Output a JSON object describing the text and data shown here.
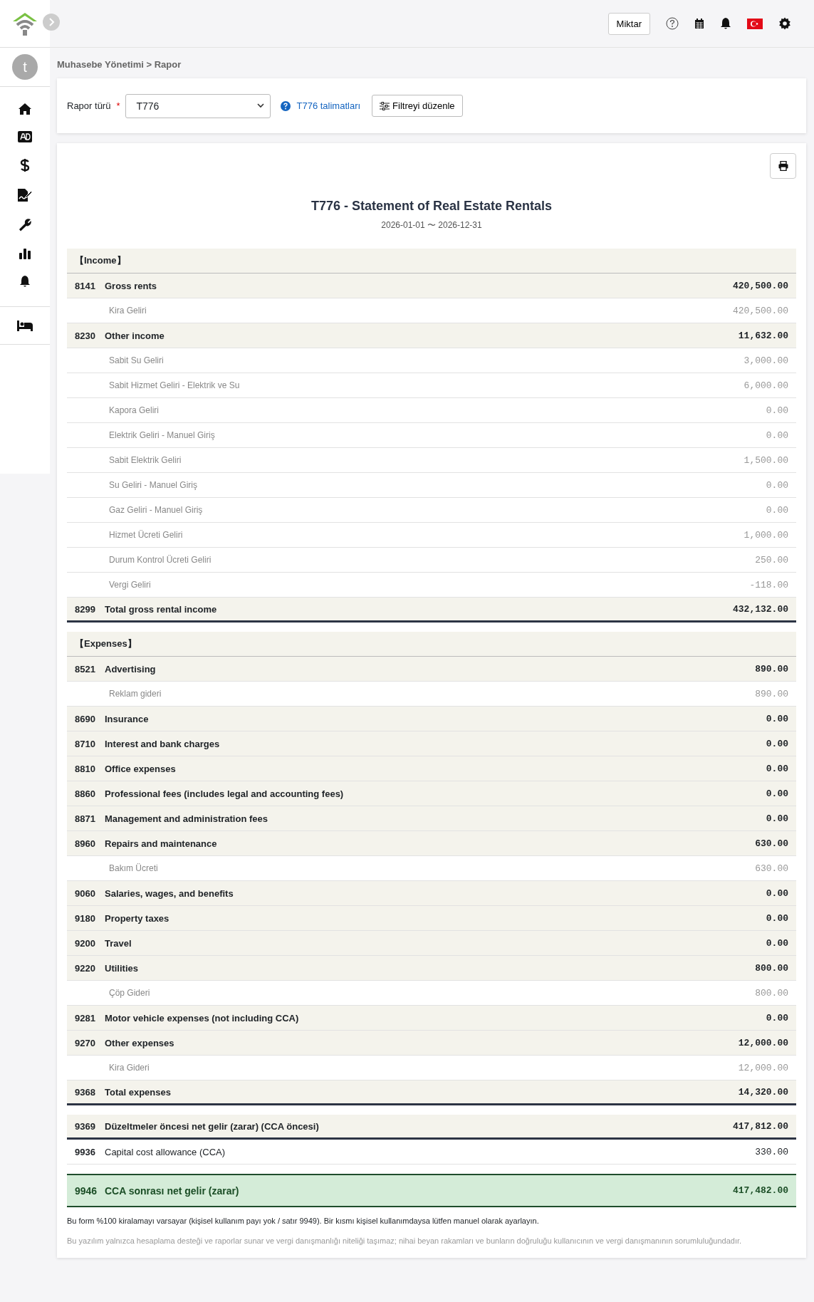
{
  "topbar": {
    "quantity_button": "Miktar"
  },
  "sidebar": {
    "avatar": "t"
  },
  "breadcrumb": "Muhasebe Yönetimi > Rapor",
  "filter": {
    "label": "Rapor türü",
    "required": "*",
    "report_type": "T776",
    "help_link": "T776 talimatları",
    "edit_button": "Filtreyi düzenle"
  },
  "report": {
    "title": "T776 - Statement of Real Estate Rentals",
    "period": "2026-01-01 〜 2026-12-31",
    "groups": [
      [
        {
          "kind": "section",
          "label": "【Income】"
        },
        {
          "kind": "account",
          "code": "8141",
          "label": "Gross rents",
          "amount": "420,500.00"
        },
        {
          "kind": "detail",
          "label": "Kira Geliri",
          "amount": "420,500.00"
        },
        {
          "kind": "account",
          "code": "8230",
          "label": "Other income",
          "amount": "11,632.00"
        },
        {
          "kind": "detail",
          "label": "Sabit Su Geliri",
          "amount": "3,000.00"
        },
        {
          "kind": "detail",
          "label": "Sabit Hizmet Geliri - Elektrik ve Su",
          "amount": "6,000.00"
        },
        {
          "kind": "detail",
          "label": "Kapora Geliri",
          "amount": "0.00"
        },
        {
          "kind": "detail",
          "label": "Elektrik Geliri - Manuel Giriş",
          "amount": "0.00"
        },
        {
          "kind": "detail",
          "label": "Sabit Elektrik Geliri",
          "amount": "1,500.00"
        },
        {
          "kind": "detail",
          "label": "Su Geliri - Manuel Giriş",
          "amount": "0.00"
        },
        {
          "kind": "detail",
          "label": "Gaz Geliri - Manuel Giriş",
          "amount": "0.00"
        },
        {
          "kind": "detail",
          "label": "Hizmet Ücreti Geliri",
          "amount": "1,000.00"
        },
        {
          "kind": "detail",
          "label": "Durum Kontrol Ücreti Geliri",
          "amount": "250.00"
        },
        {
          "kind": "detail",
          "label": "Vergi Geliri",
          "amount": "-118.00"
        },
        {
          "kind": "total",
          "code": "8299",
          "label": "Total gross rental income",
          "amount": "432,132.00"
        }
      ],
      [
        {
          "kind": "section",
          "label": "【Expenses】"
        },
        {
          "kind": "account",
          "code": "8521",
          "label": "Advertising",
          "amount": "890.00"
        },
        {
          "kind": "detail",
          "label": "Reklam gideri",
          "amount": "890.00"
        },
        {
          "kind": "account",
          "code": "8690",
          "label": "Insurance",
          "amount": "0.00"
        },
        {
          "kind": "account",
          "code": "8710",
          "label": "Interest and bank charges",
          "amount": "0.00"
        },
        {
          "kind": "account",
          "code": "8810",
          "label": "Office expenses",
          "amount": "0.00"
        },
        {
          "kind": "account",
          "code": "8860",
          "label": "Professional fees (includes legal and accounting fees)",
          "amount": "0.00"
        },
        {
          "kind": "account",
          "code": "8871",
          "label": "Management and administration fees",
          "amount": "0.00"
        },
        {
          "kind": "account",
          "code": "8960",
          "label": "Repairs and maintenance",
          "amount": "630.00"
        },
        {
          "kind": "detail",
          "label": "Bakım Ücreti",
          "amount": "630.00"
        },
        {
          "kind": "account",
          "code": "9060",
          "label": "Salaries, wages, and benefits",
          "amount": "0.00"
        },
        {
          "kind": "account",
          "code": "9180",
          "label": "Property taxes",
          "amount": "0.00"
        },
        {
          "kind": "account",
          "code": "9200",
          "label": "Travel",
          "amount": "0.00"
        },
        {
          "kind": "account",
          "code": "9220",
          "label": "Utilities",
          "amount": "800.00"
        },
        {
          "kind": "detail",
          "label": "Çöp Gideri",
          "amount": "800.00"
        },
        {
          "kind": "account",
          "code": "9281",
          "label": "Motor vehicle expenses (not including CCA)",
          "amount": "0.00"
        },
        {
          "kind": "account",
          "code": "9270",
          "label": "Other expenses",
          "amount": "12,000.00"
        },
        {
          "kind": "detail",
          "label": "Kira Gideri",
          "amount": "12,000.00"
        },
        {
          "kind": "total",
          "code": "9368",
          "label": "Total expenses",
          "amount": "14,320.00"
        }
      ],
      [
        {
          "kind": "total",
          "code": "9369",
          "label": "Düzeltmeler öncesi net gelir (zarar) (CCA öncesi)",
          "amount": "417,812.00"
        },
        {
          "kind": "plain",
          "code": "9936",
          "label": "Capital cost allowance (CCA)",
          "amount": "330.00"
        }
      ],
      [
        {
          "kind": "final",
          "code": "9946",
          "label": "CCA sonrası net gelir (zarar)",
          "amount": "417,482.00"
        }
      ]
    ],
    "notes": [
      {
        "kind": "info",
        "text": "Bu form %100 kiralamayı varsayar (kişisel kullanım payı yok / satır 9949). Bir kısmı kişisel kullanımdaysa lütfen manuel olarak ayarlayın."
      },
      {
        "kind": "disclaimer",
        "text": "Bu yazılım yalnızca hesaplama desteği ve raporlar sunar ve vergi danışmanlığı niteliği taşımaz; nihai beyan rakamları ve bunların doğruluğu kullanıcının ve vergi danışmanının sorumluluğundadır."
      }
    ]
  }
}
